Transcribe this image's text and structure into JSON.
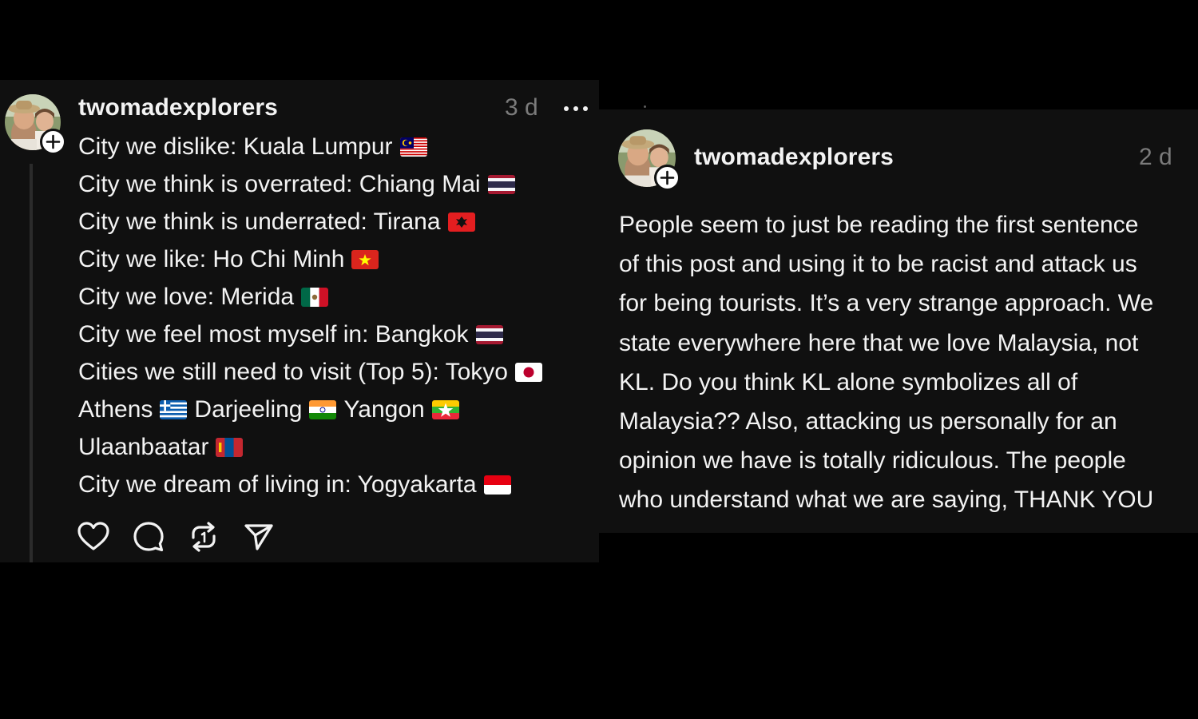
{
  "post": {
    "username": "twomadexplorers",
    "time": "3 d",
    "lines": [
      {
        "segments": [
          {
            "text": "City we dislike: Kuala Lumpur",
            "flag": "malaysia-flag"
          }
        ]
      },
      {
        "segments": [
          {
            "text": "City we think is overrated: Chiang Mai",
            "flag": "thailand-flag"
          }
        ]
      },
      {
        "segments": [
          {
            "text": "City we think is underrated: Tirana",
            "flag": "albania-flag"
          }
        ]
      },
      {
        "segments": [
          {
            "text": "City we like: Ho Chi Minh",
            "flag": "vietnam-flag"
          }
        ]
      },
      {
        "segments": [
          {
            "text": "City we love: Merida",
            "flag": "mexico-flag"
          }
        ]
      },
      {
        "segments": [
          {
            "text": "City we feel most myself in: Bangkok",
            "flag": "thailand-flag"
          }
        ]
      },
      {
        "segments": [
          {
            "text": "Cities we still need to visit (Top 5): Tokyo",
            "flag": "japan-flag"
          }
        ]
      },
      {
        "segments": [
          {
            "text": "Athens",
            "flag": "greece-flag"
          },
          {
            "text": "Darjeeling",
            "flag": "india-flag"
          },
          {
            "text": "Yangon",
            "flag": "myanmar-flag"
          }
        ]
      },
      {
        "segments": [
          {
            "text": "Ulaanbaatar",
            "flag": "mongolia-flag"
          }
        ]
      },
      {
        "segments": [
          {
            "text": "City we dream of living in: Yogyakarta",
            "flag": "indonesia-flag"
          }
        ]
      }
    ],
    "actions": [
      "heart-icon",
      "comment-icon",
      "repost-icon",
      "share-icon"
    ],
    "more_icon": "more-icon"
  },
  "reply": {
    "username": "twomadexplorers",
    "time": "2 d",
    "text_lines": [
      "People seem to just be reading the first sentence",
      "of this post and using it to be racist and attack us",
      "for being tourists. It’s a very strange approach. We",
      "state everywhere here that we love Malaysia, not",
      "KL. Do you think KL alone symbolizes all of",
      "Malaysia?? Also, attacking us personally for an",
      "opinion we have is totally ridiculous. The people",
      "who understand what we are saying, THANK YOU"
    ]
  },
  "colors": {
    "background": "#000000",
    "panel": "#101010",
    "text": "#f3f3f3",
    "muted": "#7b7b7b",
    "thread_line": "#2b2b2b"
  }
}
